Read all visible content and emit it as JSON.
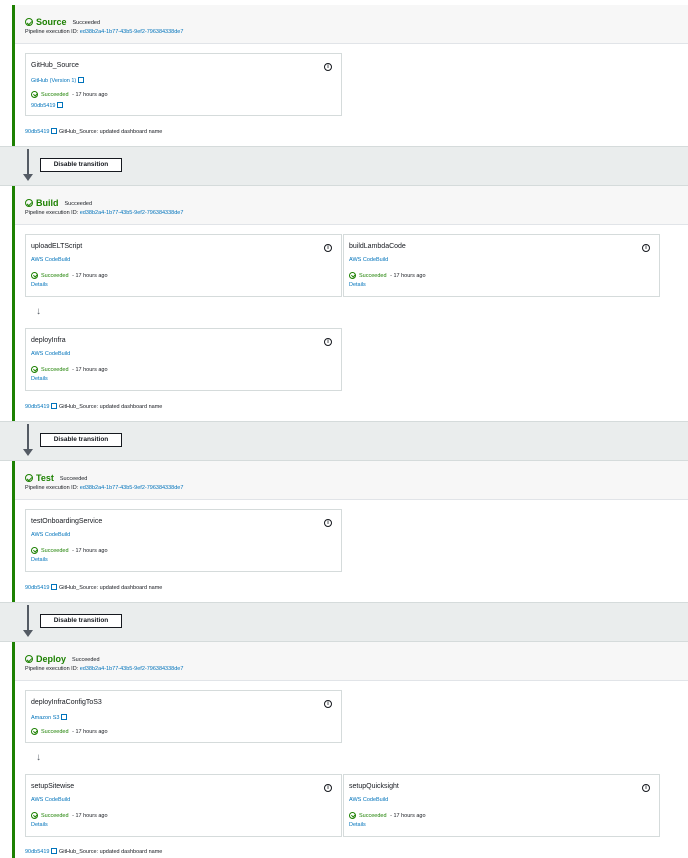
{
  "stages": {
    "source": {
      "name": "Source",
      "status": "Succeeded",
      "exec_label": "Pipeline execution ID:",
      "exec_id": "ed38b2a4-1b77-43b5-9ef2-796384338de7",
      "actions": [
        {
          "name": "GitHub_Source",
          "provider": "GitHub (Version 1)",
          "status": "Succeeded",
          "time": "17 hours ago",
          "details": "90db5419"
        }
      ],
      "commit_id": "90db5419",
      "commit_msg": "GitHub_Source: updated dashboard name"
    },
    "build": {
      "name": "Build",
      "status": "Succeeded",
      "exec_label": "Pipeline execution ID:",
      "exec_id": "ed38b2a4-1b77-43b5-9ef2-796384338de7",
      "actions": [
        {
          "name": "uploadELTScript",
          "provider": "AWS CodeBuild",
          "status": "Succeeded",
          "time": "17 hours ago",
          "details": "Details"
        },
        {
          "name": "buildLambdaCode",
          "provider": "AWS CodeBuild",
          "status": "Succeeded",
          "time": "17 hours ago",
          "details": "Details"
        },
        {
          "name": "deployInfra",
          "provider": "AWS CodeBuild",
          "status": "Succeeded",
          "time": "17 hours ago",
          "details": "Details"
        }
      ],
      "commit_id": "90db5419",
      "commit_msg": "GitHub_Source: updated dashboard name"
    },
    "test": {
      "name": "Test",
      "status": "Succeeded",
      "exec_label": "Pipeline execution ID:",
      "exec_id": "ed38b2a4-1b77-43b5-9ef2-796384338de7",
      "actions": [
        {
          "name": "testOnboardingService",
          "provider": "AWS CodeBuild",
          "status": "Succeeded",
          "time": "17 hours ago",
          "details": "Details"
        }
      ],
      "commit_id": "90db5419",
      "commit_msg": "GitHub_Source: updated dashboard name"
    },
    "deploy": {
      "name": "Deploy",
      "status": "Succeeded",
      "exec_label": "Pipeline execution ID:",
      "exec_id": "ed38b2a4-1b77-43b5-9ef2-796384338de7",
      "actions": [
        {
          "name": "deployInfraConfigToS3",
          "provider": "Amazon S3",
          "status": "Succeeded",
          "time": "17 hours ago"
        },
        {
          "name": "setupSitewise",
          "provider": "AWS CodeBuild",
          "status": "Succeeded",
          "time": "17 hours ago",
          "details": "Details"
        },
        {
          "name": "setupQuicksight",
          "provider": "AWS CodeBuild",
          "status": "Succeeded",
          "time": "17 hours ago",
          "details": "Details"
        }
      ],
      "commit_id": "90db5419",
      "commit_msg": "GitHub_Source: updated dashboard name"
    }
  },
  "transitions": {
    "button_label": "Disable transition"
  },
  "common": {
    "dot": "-",
    "info": "i",
    "arrow": "↓"
  },
  "colors": {
    "success": "#1d8102",
    "link": "#0073bb"
  }
}
